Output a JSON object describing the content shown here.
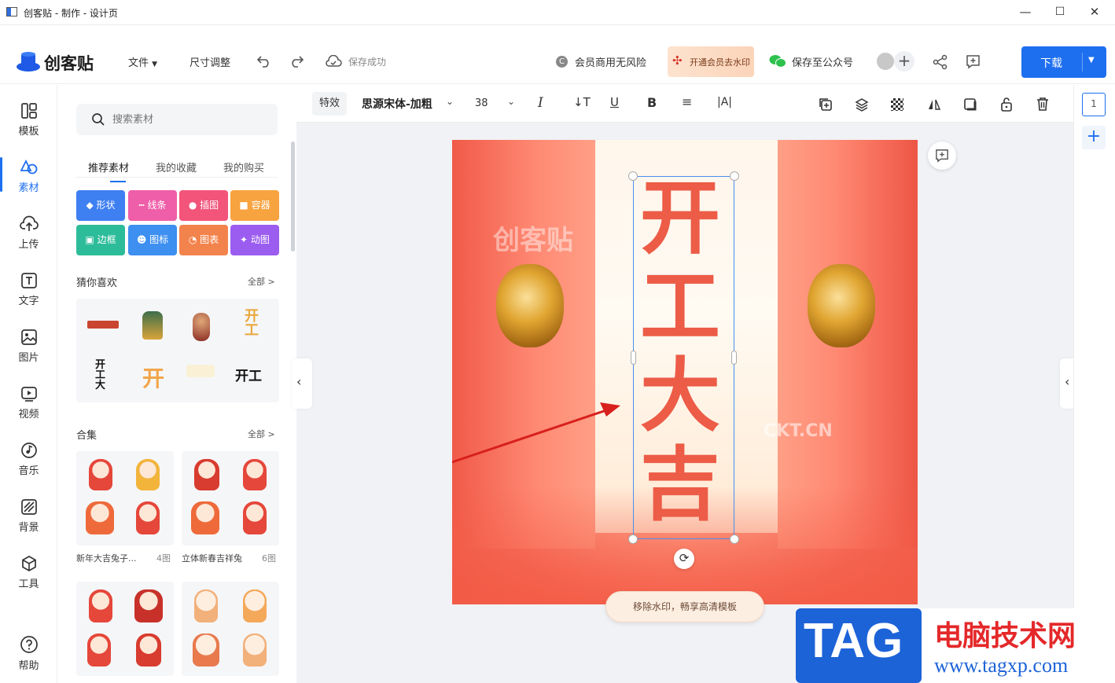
{
  "window": {
    "title": "创客贴 - 制作 - 设计页",
    "min": "—",
    "max": "☐",
    "close": "✕"
  },
  "header": {
    "logo_text": "创客贴",
    "file_menu": "文件",
    "resize": "尺寸调整",
    "save_status": "保存成功",
    "commercial": "会员商用无风险",
    "vip_watermark": "开通会员去水印",
    "save_wechat": "保存至公众号",
    "download": "下载"
  },
  "nav": {
    "items": [
      {
        "label": "模板",
        "icon": "template-icon"
      },
      {
        "label": "素材",
        "icon": "material-icon"
      },
      {
        "label": "上传",
        "icon": "upload-icon"
      },
      {
        "label": "文字",
        "icon": "text-icon"
      },
      {
        "label": "图片",
        "icon": "image-icon"
      },
      {
        "label": "视频",
        "icon": "video-icon"
      },
      {
        "label": "音乐",
        "icon": "music-icon"
      },
      {
        "label": "背景",
        "icon": "background-icon"
      },
      {
        "label": "工具",
        "icon": "tool-icon"
      }
    ],
    "help": "帮助"
  },
  "panel": {
    "search_placeholder": "搜索素材",
    "tabs": [
      "推荐素材",
      "我的收藏",
      "我的购买"
    ],
    "categories": [
      {
        "label": "形状",
        "color": "#3e7ff2"
      },
      {
        "label": "线条",
        "color": "#ef5ea8"
      },
      {
        "label": "插图",
        "color": "#f2547a"
      },
      {
        "label": "容器",
        "color": "#f7a33f"
      },
      {
        "label": "边框",
        "color": "#2dbc9a"
      },
      {
        "label": "图标",
        "color": "#3d8ff0"
      },
      {
        "label": "图表",
        "color": "#f3834c"
      },
      {
        "label": "动图",
        "color": "#9b5cf0"
      }
    ],
    "guess_title": "猜你喜欢",
    "guess_more": "全部 >",
    "collection_title": "合集",
    "collection_more": "全部 >",
    "collections": [
      {
        "name": "新年大吉兔子...",
        "count": "4图"
      },
      {
        "name": "立体新春吉祥兔",
        "count": "6图"
      }
    ]
  },
  "toolbar": {
    "effects": "特效",
    "font": "思源宋体-加粗",
    "size": "38"
  },
  "canvas": {
    "text": "开工大吉",
    "watermark_logo": "创客贴",
    "watermark_url": "CKT.CN",
    "remove_watermark": "移除水印，畅享高清模板"
  },
  "pages": {
    "current": "1"
  },
  "site_badge": {
    "tag": "TAG",
    "name": "电脑技术网",
    "url": "www.tagxp.com"
  }
}
